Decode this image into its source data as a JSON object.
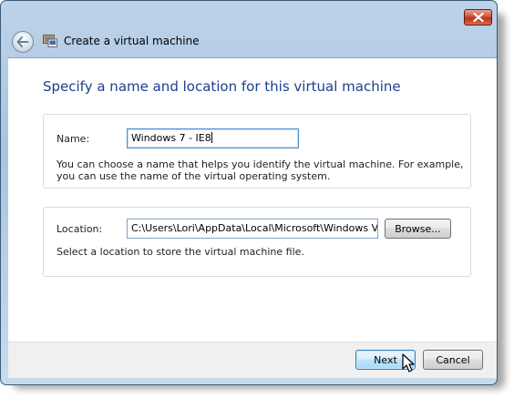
{
  "window": {
    "title": "Create a virtual machine"
  },
  "heading": "Specify a name and location for this virtual machine",
  "name_section": {
    "label": "Name:",
    "value": "Windows 7 - IE8",
    "help_line1": "You can choose a name that helps you identify the virtual machine. For example,",
    "help_line2": "you can use the name of the virtual operating system."
  },
  "location_section": {
    "label": "Location:",
    "value": "C:\\Users\\Lori\\AppData\\Local\\Microsoft\\Windows Virtual PC\\Virtual Machines",
    "browse_label": "Browse...",
    "help": "Select a location to store the virtual machine file."
  },
  "footer": {
    "next_label": "Next",
    "cancel_label": "Cancel"
  },
  "colors": {
    "heading": "#1d3f8e",
    "close_button": "#c8442a",
    "accent_border": "#3c7fb1"
  },
  "icons": {
    "close": "close-icon",
    "back": "back-arrow-icon",
    "app": "virtual-machine-icon",
    "cursor": "mouse-pointer-icon"
  }
}
